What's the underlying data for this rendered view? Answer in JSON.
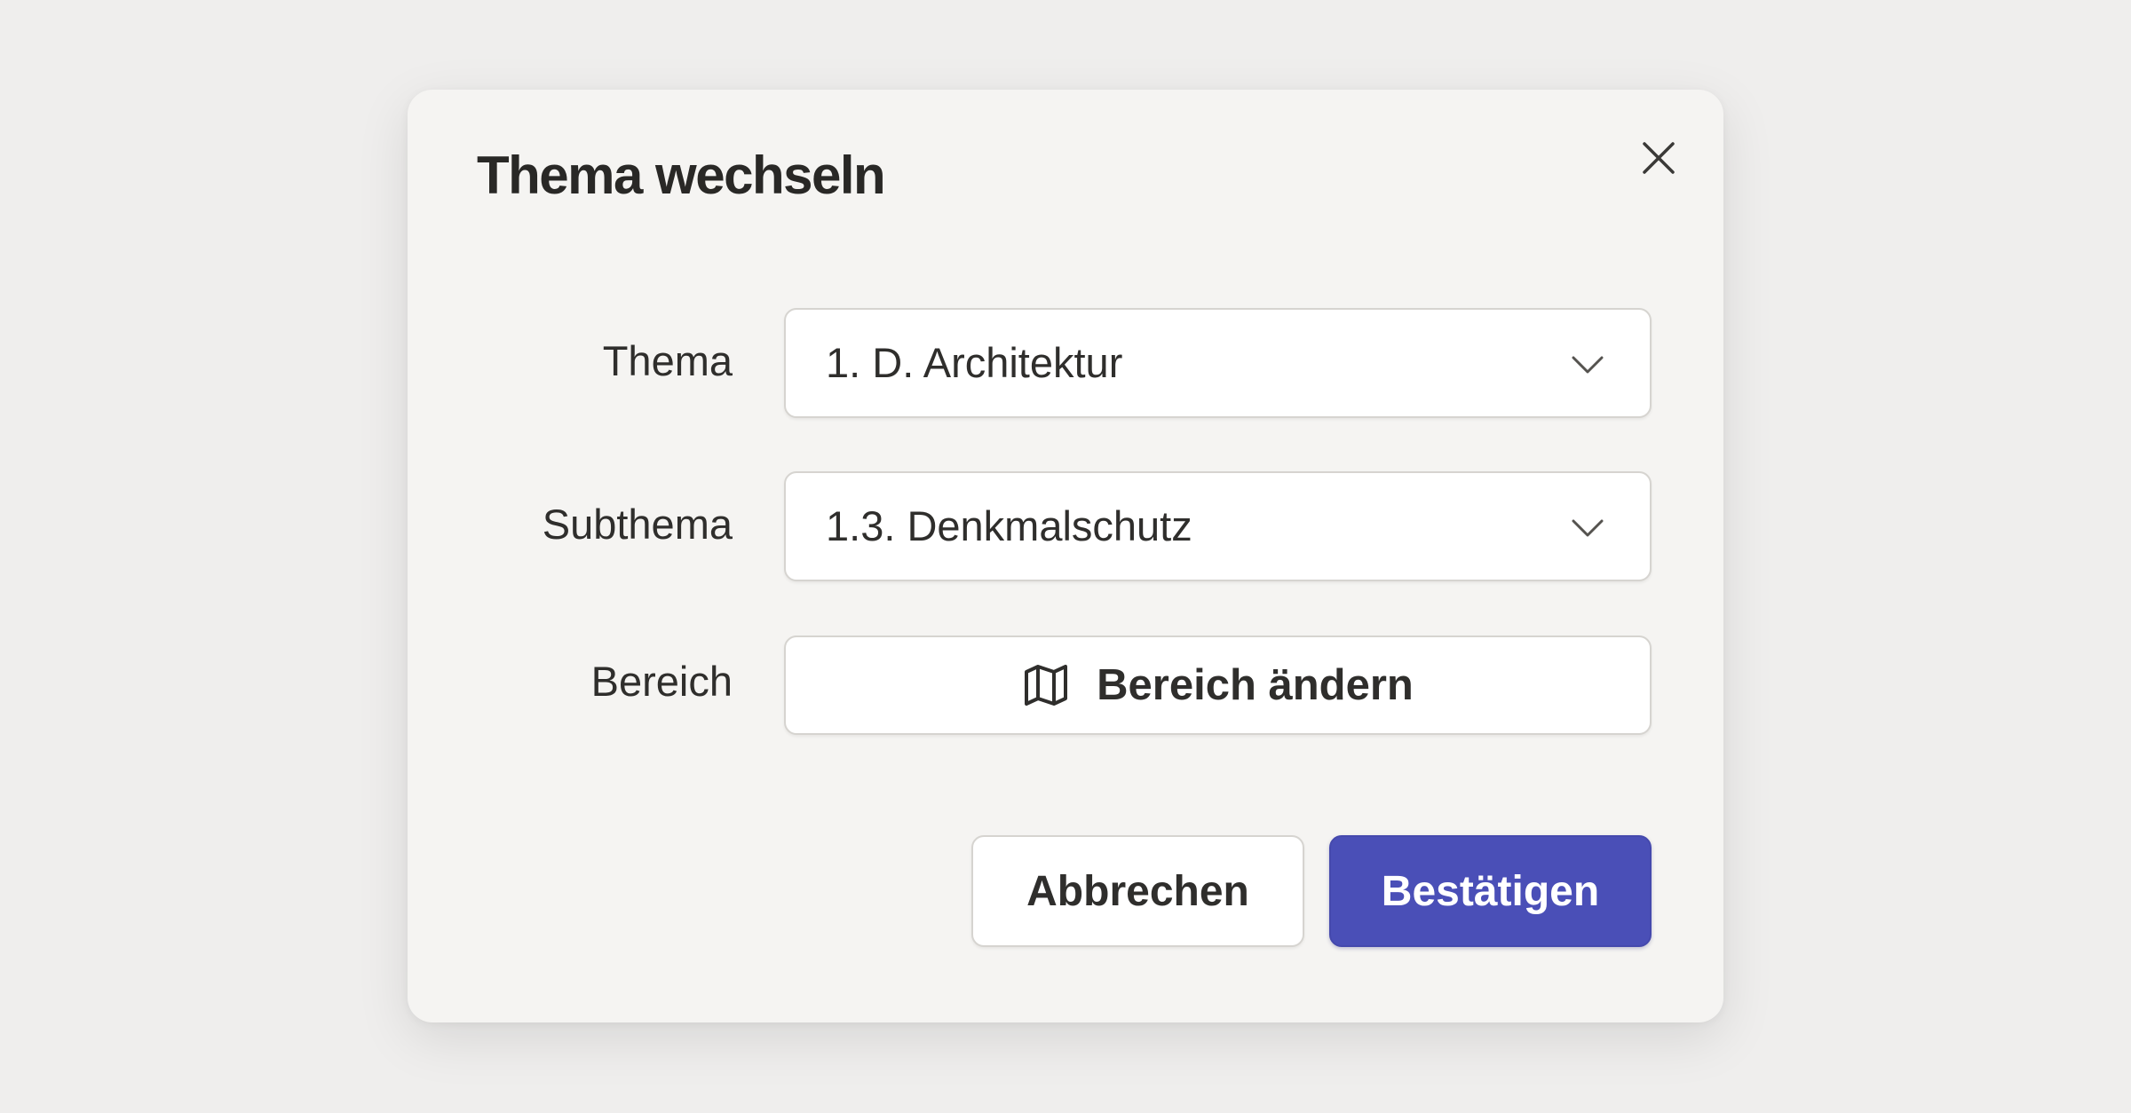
{
  "dialog": {
    "title": "Thema wechseln",
    "close_icon": "close-icon"
  },
  "fields": {
    "topic": {
      "label": "Thema",
      "value": "1. D. Architektur",
      "icon": "chevron-down-icon"
    },
    "subtopic": {
      "label": "Subthema",
      "value": "1.3. Denkmalschutz",
      "icon": "chevron-down-icon"
    },
    "area": {
      "label": "Bereich",
      "button_label": "Bereich ändern",
      "icon": "map-icon"
    }
  },
  "actions": {
    "cancel_label": "Abbrechen",
    "confirm_label": "Bestätigen"
  },
  "colors": {
    "primary": "#4a4fb7",
    "background": "#efeeed",
    "dialog_background": "#f5f4f2"
  }
}
